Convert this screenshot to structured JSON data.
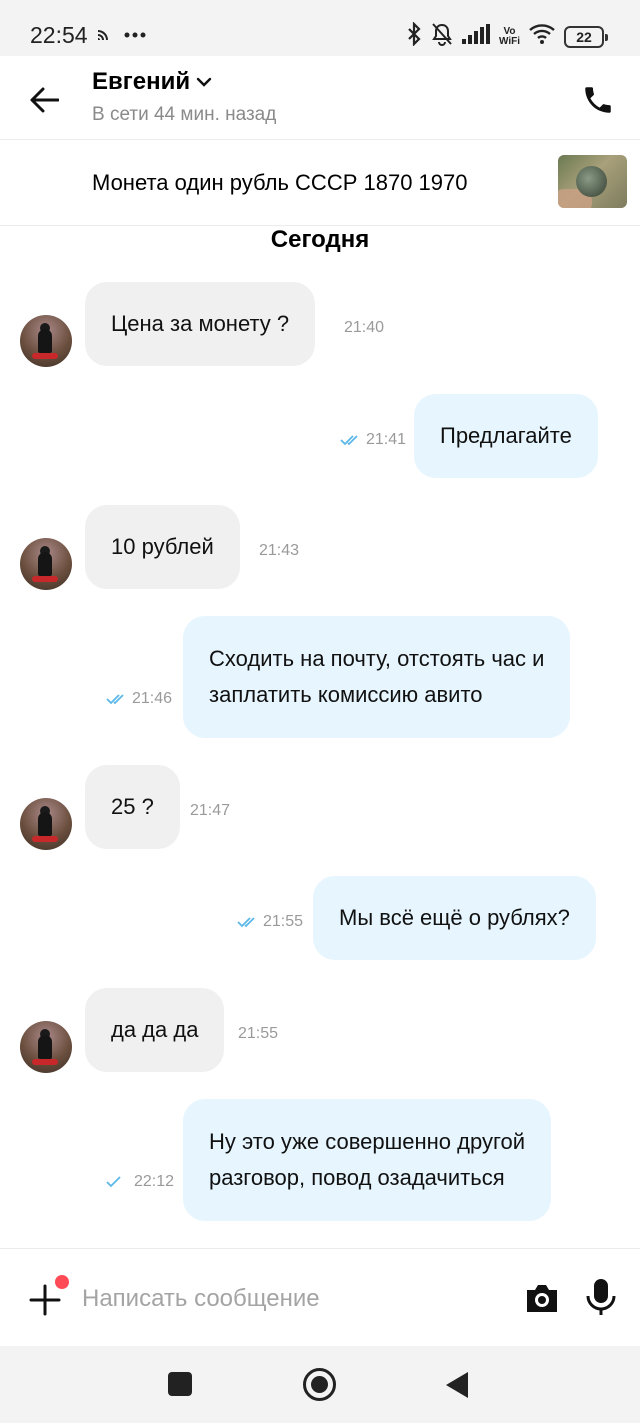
{
  "status_bar": {
    "time": "22:54",
    "vowifi_top": "Vo",
    "vowifi_bottom": "WiFi",
    "battery": "22",
    "icons": [
      "cast-icon",
      "more-dots-icon",
      "bluetooth-icon",
      "mute-bell-icon",
      "signal-icon",
      "vowifi-icon",
      "wifi-icon",
      "battery-icon"
    ]
  },
  "header": {
    "contact_name": "Евгений",
    "contact_status": "В сети 44 мин. назад"
  },
  "listing": {
    "title": "Монета один рубль СССР 1870 1970"
  },
  "date_separator": "Сегодня",
  "messages": [
    {
      "direction": "in",
      "lines": [
        "Цена за монету ?"
      ],
      "time": "21:40"
    },
    {
      "direction": "out",
      "lines": [
        "Предлагайте"
      ],
      "time": "21:41",
      "status": "read"
    },
    {
      "direction": "in",
      "lines": [
        "10 рублей"
      ],
      "time": "21:43"
    },
    {
      "direction": "out",
      "lines": [
        "Сходить на почту, отстоять час и",
        "заплатить комиссию авито"
      ],
      "time": "21:46",
      "status": "read"
    },
    {
      "direction": "in",
      "lines": [
        "25 ?"
      ],
      "time": "21:47"
    },
    {
      "direction": "out",
      "lines": [
        "Мы всё ещё о рублях?"
      ],
      "time": "21:55",
      "status": "read"
    },
    {
      "direction": "in",
      "lines": [
        "да да да"
      ],
      "time": "21:55"
    },
    {
      "direction": "out",
      "lines": [
        "Ну это уже совершенно другой",
        "разговор, повод озадачиться"
      ],
      "time": "22:12",
      "status": "sent"
    }
  ],
  "composer": {
    "placeholder": "Написать сообщение"
  },
  "colors": {
    "incoming_bubble": "#f0f0f0",
    "outgoing_bubble": "#e6f5fe",
    "check_read": "#5bb8e8",
    "check_sent": "#5bb8e8",
    "attach_dot": "#ff4b55"
  }
}
